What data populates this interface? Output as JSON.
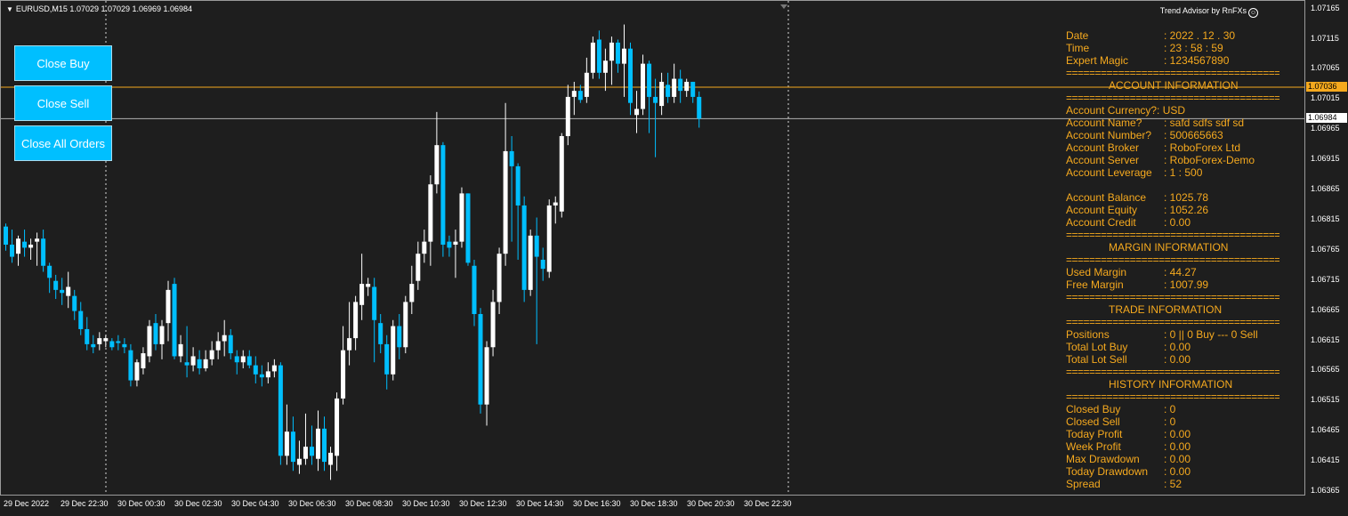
{
  "symbol_header": {
    "text": "EURUSD,M15  1.07029 1.07029 1.06969 1.06984"
  },
  "brand": {
    "text": "Trend Advisor by RnFXs"
  },
  "buttons": {
    "close_buy": "Close Buy",
    "close_sell": "Close Sell",
    "close_all": "Close All Orders"
  },
  "panel": [
    {
      "type": "kv",
      "label": "Date",
      "value": ": 2022 . 12 . 30"
    },
    {
      "type": "kv",
      "label": "Time",
      "value": ": 23 : 58 : 59"
    },
    {
      "type": "kv",
      "label": "Expert Magic",
      "value": ": 1234567890"
    },
    {
      "type": "sep",
      "text": "=========================================="
    },
    {
      "type": "hdr",
      "text": "ACCOUNT INFORMATION"
    },
    {
      "type": "sep",
      "text": "=========================================="
    },
    {
      "type": "line",
      "text": "Account Currency?: USD"
    },
    {
      "type": "kv",
      "label": "Account Name?",
      "value": ": safd    sdfs sdf  sd"
    },
    {
      "type": "kv",
      "label": "Account Number?",
      "value": ": 500665663"
    },
    {
      "type": "kv",
      "label": "Account Broker",
      "value": ": RoboForex Ltd"
    },
    {
      "type": "kv",
      "label": "Account Server",
      "value": ": RoboForex-Demo"
    },
    {
      "type": "kv",
      "label": "Account Leverage",
      "value": ": 1 : 500"
    },
    {
      "type": "blank",
      "text": ""
    },
    {
      "type": "kv",
      "label": "Account Balance",
      "value": ": 1025.78"
    },
    {
      "type": "kv",
      "label": "Account Equity",
      "value": ": 1052.26"
    },
    {
      "type": "kv",
      "label": "Account Credit",
      "value": ": 0.00"
    },
    {
      "type": "sep",
      "text": "=========================================="
    },
    {
      "type": "hdr",
      "text": "MARGIN INFORMATION"
    },
    {
      "type": "sep",
      "text": "=========================================="
    },
    {
      "type": "kv",
      "label": "Used Margin",
      "value": ": 44.27"
    },
    {
      "type": "kv",
      "label": "Free Margin",
      "value": ": 1007.99"
    },
    {
      "type": "sep",
      "text": "=========================================="
    },
    {
      "type": "hdr",
      "text": "TRADE INFORMATION"
    },
    {
      "type": "sep",
      "text": "=========================================="
    },
    {
      "type": "kv",
      "label": "Positions",
      "value": ": 0  ||  0 Buy --- 0 Sell"
    },
    {
      "type": "kv",
      "label": "Total Lot Buy",
      "value": ": 0.00"
    },
    {
      "type": "kv",
      "label": "Total Lot Sell",
      "value": ": 0.00"
    },
    {
      "type": "sep",
      "text": "=========================================="
    },
    {
      "type": "hdr",
      "text": "HISTORY INFORMATION"
    },
    {
      "type": "sep",
      "text": "=========================================="
    },
    {
      "type": "kv",
      "label": "Closed Buy",
      "value": ": 0"
    },
    {
      "type": "kv",
      "label": "Closed Sell",
      "value": ": 0"
    },
    {
      "type": "kv",
      "label": "Today Profit",
      "value": ": 0.00"
    },
    {
      "type": "kv",
      "label": "Week Profit",
      "value": ": 0.00"
    },
    {
      "type": "kv",
      "label": "Max Drawdown",
      "value": ": 0.00"
    },
    {
      "type": "kv",
      "label": "Today Drawdown",
      "value": ": 0.00"
    },
    {
      "type": "kv",
      "label": "Spread",
      "value": ": 52"
    }
  ],
  "price_axis": [
    "1.07165",
    "1.07115",
    "1.07065",
    "1.07015",
    "1.06965",
    "1.06915",
    "1.06865",
    "1.06815",
    "1.06765",
    "1.06715",
    "1.06665",
    "1.06615",
    "1.06565",
    "1.06515",
    "1.06465",
    "1.06415",
    "1.06365"
  ],
  "price_tags": {
    "ask": "1.07036",
    "bid": "1.06984"
  },
  "time_axis": [
    "29 Dec 2022",
    "29 Dec 22:30",
    "30 Dec 00:30",
    "30 Dec 02:30",
    "30 Dec 04:30",
    "30 Dec 06:30",
    "30 Dec 08:30",
    "30 Dec 10:30",
    "30 Dec 12:30",
    "30 Dec 14:30",
    "30 Dec 16:30",
    "30 Dec 18:30",
    "30 Dec 20:30",
    "30 Dec 22:30"
  ],
  "colors": {
    "background": "#1e1e1e",
    "bull": "#ffffff",
    "bear": "#00bfff",
    "panel_text": "#f5a91e",
    "ask_line": "#f5a91e",
    "bid_line": "#b0b0b0",
    "button": "#00bfff"
  },
  "chart_data": {
    "type": "candlestick",
    "symbol": "EURUSD",
    "timeframe": "M15",
    "ylim": [
      1.06355,
      1.07175
    ],
    "ohlc": [
      [
        1.06805,
        1.0681,
        1.06765,
        1.06775
      ],
      [
        1.06775,
        1.068,
        1.06745,
        1.06755
      ],
      [
        1.0676,
        1.0679,
        1.0674,
        1.06785
      ],
      [
        1.0678,
        1.068,
        1.06755,
        1.0677
      ],
      [
        1.0677,
        1.06785,
        1.0675,
        1.06775
      ],
      [
        1.0678,
        1.06795,
        1.0674,
        1.06785
      ],
      [
        1.06785,
        1.068,
        1.0673,
        1.0674
      ],
      [
        1.0674,
        1.06745,
        1.06695,
        1.0672
      ],
      [
        1.06715,
        1.06725,
        1.06685,
        1.067
      ],
      [
        1.067,
        1.0672,
        1.06675,
        1.06695
      ],
      [
        1.0669,
        1.0673,
        1.0667,
        1.06705
      ],
      [
        1.0669,
        1.067,
        1.0665,
        1.06665
      ],
      [
        1.06665,
        1.0668,
        1.06625,
        1.06635
      ],
      [
        1.06635,
        1.06655,
        1.066,
        1.0661
      ],
      [
        1.0661,
        1.06625,
        1.06595,
        1.06605
      ],
      [
        1.0661,
        1.0663,
        1.066,
        1.0662
      ],
      [
        1.06615,
        1.06625,
        1.06605,
        1.0662
      ],
      [
        1.06615,
        1.0662,
        1.066,
        1.06605
      ],
      [
        1.06615,
        1.06625,
        1.066,
        1.06612
      ],
      [
        1.0661,
        1.0662,
        1.06595,
        1.06605
      ],
      [
        1.066,
        1.0661,
        1.0654,
        1.0655
      ],
      [
        1.0655,
        1.06585,
        1.0654,
        1.0658
      ],
      [
        1.0657,
        1.06605,
        1.0656,
        1.06595
      ],
      [
        1.0659,
        1.0665,
        1.0658,
        1.0664
      ],
      [
        1.06645,
        1.0666,
        1.066,
        1.0661
      ],
      [
        1.0661,
        1.0665,
        1.06585,
        1.0664
      ],
      [
        1.06645,
        1.06715,
        1.06615,
        1.067
      ],
      [
        1.0671,
        1.0672,
        1.06585,
        1.0659
      ],
      [
        1.0659,
        1.06625,
        1.0658,
        1.0661
      ],
      [
        1.0658,
        1.0664,
        1.06555,
        1.06575
      ],
      [
        1.06575,
        1.06605,
        1.06565,
        1.0659
      ],
      [
        1.06585,
        1.066,
        1.0656,
        1.0657
      ],
      [
        1.0657,
        1.066,
        1.06565,
        1.06585
      ],
      [
        1.06585,
        1.06615,
        1.06575,
        1.066
      ],
      [
        1.066,
        1.0663,
        1.06585,
        1.06615
      ],
      [
        1.06615,
        1.0665,
        1.0659,
        1.06625
      ],
      [
        1.06625,
        1.06635,
        1.06585,
        1.06595
      ],
      [
        1.0659,
        1.066,
        1.0656,
        1.0658
      ],
      [
        1.0658,
        1.066,
        1.0657,
        1.0659
      ],
      [
        1.0659,
        1.066,
        1.0657,
        1.06575
      ],
      [
        1.06575,
        1.0659,
        1.06545,
        1.0656
      ],
      [
        1.0656,
        1.06575,
        1.0654,
        1.06555
      ],
      [
        1.06555,
        1.0658,
        1.06545,
        1.06565
      ],
      [
        1.06565,
        1.06585,
        1.06555,
        1.06575
      ],
      [
        1.06575,
        1.0658,
        1.0641,
        1.06425
      ],
      [
        1.06425,
        1.0651,
        1.0641,
        1.06465
      ],
      [
        1.06465,
        1.0649,
        1.064,
        1.06415
      ],
      [
        1.0641,
        1.0645,
        1.06395,
        1.0642
      ],
      [
        1.0642,
        1.06495,
        1.0641,
        1.0644
      ],
      [
        1.0644,
        1.06475,
        1.0641,
        1.06425
      ],
      [
        1.0642,
        1.065,
        1.064,
        1.0647
      ],
      [
        1.0647,
        1.0649,
        1.064,
        1.06415
      ],
      [
        1.0641,
        1.0644,
        1.06385,
        1.0643
      ],
      [
        1.06425,
        1.0653,
        1.064,
        1.0652
      ],
      [
        1.0652,
        1.0664,
        1.0651,
        1.066
      ],
      [
        1.066,
        1.0668,
        1.06575,
        1.0662
      ],
      [
        1.0662,
        1.0669,
        1.066,
        1.0668
      ],
      [
        1.06675,
        1.0676,
        1.0665,
        1.0671
      ],
      [
        1.06705,
        1.0672,
        1.0669,
        1.0671
      ],
      [
        1.06705,
        1.0672,
        1.0658,
        1.0665
      ],
      [
        1.06645,
        1.0666,
        1.06595,
        1.0661
      ],
      [
        1.0661,
        1.06625,
        1.06535,
        1.0656
      ],
      [
        1.0656,
        1.0665,
        1.0655,
        1.0664
      ],
      [
        1.0664,
        1.0666,
        1.06585,
        1.06605
      ],
      [
        1.06605,
        1.0669,
        1.06595,
        1.0668
      ],
      [
        1.0668,
        1.0674,
        1.0666,
        1.0671
      ],
      [
        1.06715,
        1.0678,
        1.067,
        1.0676
      ],
      [
        1.0676,
        1.068,
        1.06745,
        1.0678
      ],
      [
        1.0678,
        1.0689,
        1.0674,
        1.06875
      ],
      [
        1.06875,
        1.06995,
        1.0686,
        1.0694
      ],
      [
        1.0694,
        1.06945,
        1.06755,
        1.06775
      ],
      [
        1.0678,
        1.0679,
        1.06755,
        1.0677
      ],
      [
        1.06775,
        1.068,
        1.0672,
        1.0678
      ],
      [
        1.0678,
        1.0687,
        1.0677,
        1.0686
      ],
      [
        1.0686,
        1.0686,
        1.0674,
        1.06745
      ],
      [
        1.0674,
        1.0675,
        1.0664,
        1.0666
      ],
      [
        1.0666,
        1.0667,
        1.06495,
        1.0651
      ],
      [
        1.0651,
        1.06615,
        1.06475,
        1.06605
      ],
      [
        1.06605,
        1.067,
        1.0659,
        1.0668
      ],
      [
        1.0668,
        1.0677,
        1.0666,
        1.0676
      ],
      [
        1.0676,
        1.0701,
        1.0674,
        1.0693
      ],
      [
        1.0693,
        1.06955,
        1.0678,
        1.06905
      ],
      [
        1.06905,
        1.0691,
        1.0675,
        1.0684
      ],
      [
        1.0684,
        1.06855,
        1.0668,
        1.067
      ],
      [
        1.067,
        1.068,
        1.0669,
        1.0679
      ],
      [
        1.0679,
        1.0682,
        1.0661,
        1.06755
      ],
      [
        1.0675,
        1.0677,
        1.06715,
        1.06735
      ],
      [
        1.0673,
        1.0685,
        1.0672,
        1.0684
      ],
      [
        1.0684,
        1.06855,
        1.0681,
        1.06845
      ],
      [
        1.0683,
        1.0696,
        1.0682,
        1.06955
      ],
      [
        1.06955,
        1.0704,
        1.0694,
        1.0702
      ],
      [
        1.0702,
        1.07045,
        1.0699,
        1.0703
      ],
      [
        1.0703,
        1.0704,
        1.0701,
        1.07015
      ],
      [
        1.0702,
        1.07085,
        1.0701,
        1.0706
      ],
      [
        1.0706,
        1.0712,
        1.0705,
        1.0711
      ],
      [
        1.07115,
        1.0713,
        1.0705,
        1.0706
      ],
      [
        1.0706,
        1.071,
        1.0703,
        1.0708
      ],
      [
        1.0708,
        1.0712,
        1.0704,
        1.0711
      ],
      [
        1.0711,
        1.07115,
        1.0706,
        1.07075
      ],
      [
        1.07075,
        1.0714,
        1.0702,
        1.071
      ],
      [
        1.071,
        1.0711,
        1.0699,
        1.0701
      ],
      [
        1.0699,
        1.0703,
        1.0696,
        1.07
      ],
      [
        1.07,
        1.0709,
        1.0699,
        1.07075
      ],
      [
        1.07075,
        1.0708,
        1.0696,
        1.0702
      ],
      [
        1.0702,
        1.0705,
        1.0692,
        1.0701
      ],
      [
        1.07005,
        1.0706,
        1.0699,
        1.07045
      ],
      [
        1.0704,
        1.0706,
        1.0701,
        1.0702
      ],
      [
        1.0702,
        1.07075,
        1.0701,
        1.0705
      ],
      [
        1.0705,
        1.07065,
        1.0701,
        1.0703
      ],
      [
        1.0703,
        1.0705,
        1.0702,
        1.07045
      ],
      [
        1.07045,
        1.07045,
        1.0701,
        1.0702
      ],
      [
        1.0702,
        1.07029,
        1.06969,
        1.06984
      ]
    ]
  }
}
